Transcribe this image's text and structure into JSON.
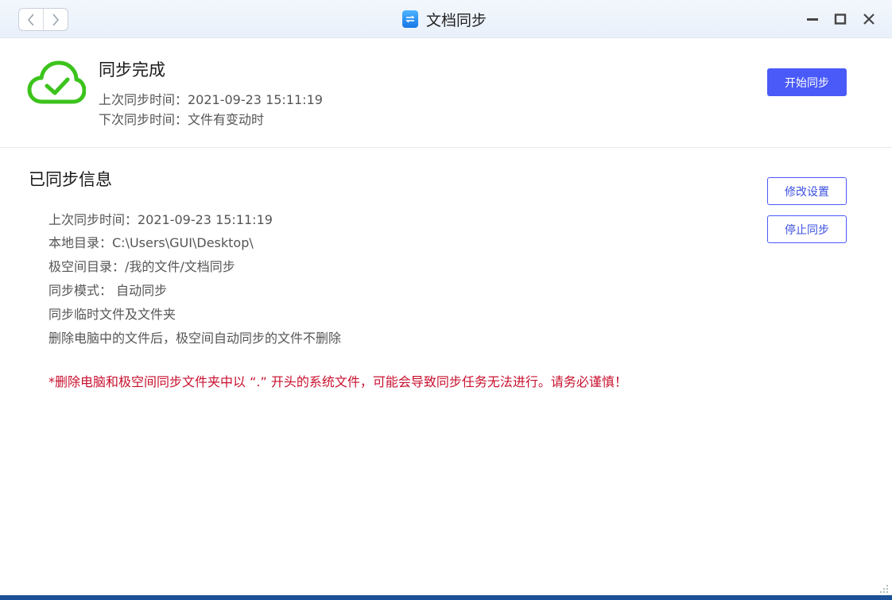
{
  "window": {
    "title": "文档同步",
    "icons": {
      "back": "chevron-left-icon",
      "forward": "chevron-right-icon",
      "app": "sync-doc-icon",
      "minimize": "minimize-icon",
      "maximize": "maximize-icon",
      "close": "close-icon"
    }
  },
  "status": {
    "title": "同步完成",
    "last_sync": "上次同步时间：2021-09-23 15:11:19",
    "next_sync": "下次同步时间：文件有变动时",
    "icon": "cloud-check-icon",
    "start_button": "开始同步"
  },
  "info": {
    "title": "已同步信息",
    "lines": [
      "上次同步时间：2021-09-23 15:11:19",
      "本地目录：C:\\Users\\GUI\\Desktop\\",
      "极空间目录：/我的文件/文档同步",
      "同步模式： 自动同步",
      "同步临时文件及文件夹",
      "删除电脑中的文件后，极空间自动同步的文件不删除"
    ],
    "warning": "*删除电脑和极空间同步文件夹中以 “.” 开头的系统文件，可能会导致同步任务无法进行。请务必谨慎！",
    "edit_button": "修改设置",
    "stop_button": "停止同步"
  },
  "colors": {
    "accent": "#4a5af8",
    "success": "#3cc31c",
    "warning": "#c8102e",
    "footer": "#1b4f96"
  }
}
